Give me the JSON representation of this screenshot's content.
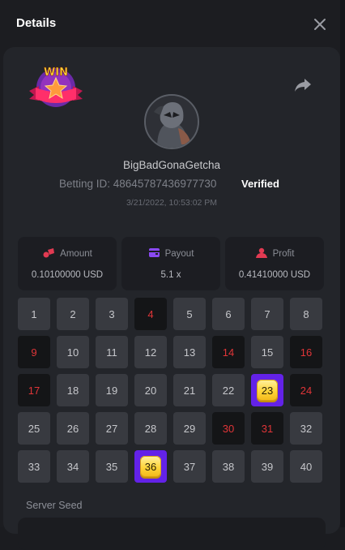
{
  "header": {
    "title": "Details"
  },
  "player": {
    "username": "BigBadGonaGetcha",
    "betting_id": "Betting ID: 48645787436977730",
    "status": "Verified",
    "datetime": "3/21/2022, 10:53:02 PM"
  },
  "badge": {
    "text": "WIN"
  },
  "stats": [
    {
      "label": "Amount",
      "value": "0.10100000 USD",
      "icon": "coins-icon"
    },
    {
      "label": "Payout",
      "value": "5.1 x",
      "icon": "wallet-icon"
    },
    {
      "label": "Profit",
      "value": "0.41410000 USD",
      "icon": "profit-icon"
    }
  ],
  "tiles": [
    {
      "n": "1",
      "state": "normal"
    },
    {
      "n": "2",
      "state": "normal"
    },
    {
      "n": "3",
      "state": "normal"
    },
    {
      "n": "4",
      "state": "red"
    },
    {
      "n": "5",
      "state": "normal"
    },
    {
      "n": "6",
      "state": "normal"
    },
    {
      "n": "7",
      "state": "normal"
    },
    {
      "n": "8",
      "state": "normal"
    },
    {
      "n": "9",
      "state": "red"
    },
    {
      "n": "10",
      "state": "normal"
    },
    {
      "n": "11",
      "state": "normal"
    },
    {
      "n": "12",
      "state": "normal"
    },
    {
      "n": "13",
      "state": "normal"
    },
    {
      "n": "14",
      "state": "red"
    },
    {
      "n": "15",
      "state": "normal"
    },
    {
      "n": "16",
      "state": "red"
    },
    {
      "n": "17",
      "state": "red"
    },
    {
      "n": "18",
      "state": "normal"
    },
    {
      "n": "19",
      "state": "normal"
    },
    {
      "n": "20",
      "state": "normal"
    },
    {
      "n": "21",
      "state": "normal"
    },
    {
      "n": "22",
      "state": "normal"
    },
    {
      "n": "23",
      "state": "hit"
    },
    {
      "n": "24",
      "state": "red"
    },
    {
      "n": "25",
      "state": "normal"
    },
    {
      "n": "26",
      "state": "normal"
    },
    {
      "n": "27",
      "state": "normal"
    },
    {
      "n": "28",
      "state": "normal"
    },
    {
      "n": "29",
      "state": "normal"
    },
    {
      "n": "30",
      "state": "red"
    },
    {
      "n": "31",
      "state": "red"
    },
    {
      "n": "32",
      "state": "normal"
    },
    {
      "n": "33",
      "state": "normal"
    },
    {
      "n": "34",
      "state": "normal"
    },
    {
      "n": "35",
      "state": "normal"
    },
    {
      "n": "36",
      "state": "hit"
    },
    {
      "n": "37",
      "state": "normal"
    },
    {
      "n": "38",
      "state": "normal"
    },
    {
      "n": "39",
      "state": "normal"
    },
    {
      "n": "40",
      "state": "normal"
    }
  ],
  "server_seed": {
    "label": "Server Seed"
  },
  "colors": {
    "background": "#1c1d21",
    "card": "#23252a",
    "tile": "#383a40",
    "red_tile_bg": "#141517",
    "red_text": "#e03538",
    "hit_border": "#6322e8",
    "hit_gem": "#ffd53a"
  }
}
